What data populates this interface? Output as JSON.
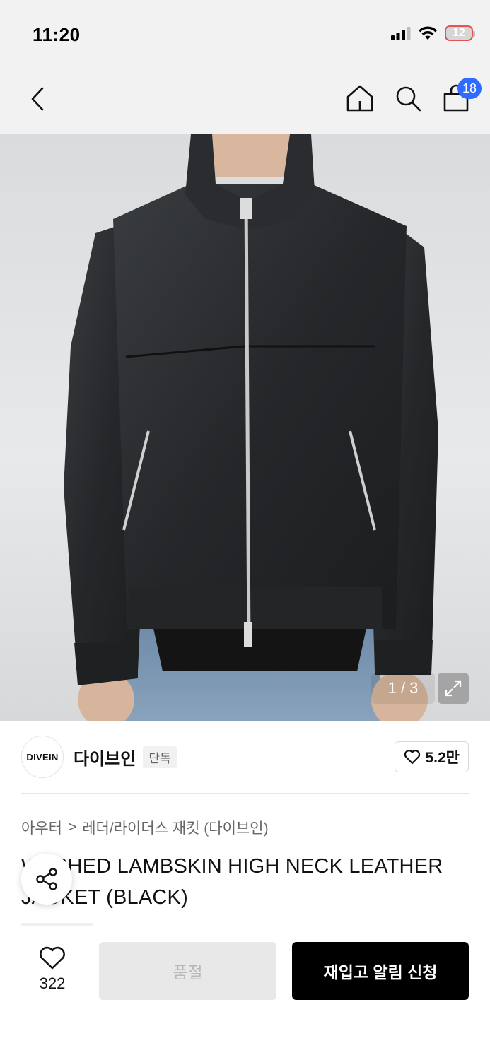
{
  "status_bar": {
    "time": "11:20",
    "battery": "12"
  },
  "nav": {
    "cart_count": "18"
  },
  "hero": {
    "counter": "1 / 3",
    "subject": "black leather high neck jacket photo"
  },
  "brand": {
    "logo_text": "DIVEIN",
    "name": "다이브인",
    "tag": "단독",
    "likes": "5.2만"
  },
  "breadcrumb": {
    "category": "아우터",
    "separator": ">",
    "subcategory": "레더/라이더스 재킷 (다이브인)"
  },
  "product": {
    "title_line1": "WASHED LAMBSKIN HIGH NECK LEATHER",
    "title_line2": "JACKET (BLACK)"
  },
  "bottom_bar": {
    "wish_count": "322",
    "soldout_label": "품절",
    "restock_label": "재입고 알림 신청"
  },
  "colors": {
    "accent_blue": "#2f6bff",
    "cta_black": "#000000",
    "disabled_bg": "#e8e8e8"
  }
}
